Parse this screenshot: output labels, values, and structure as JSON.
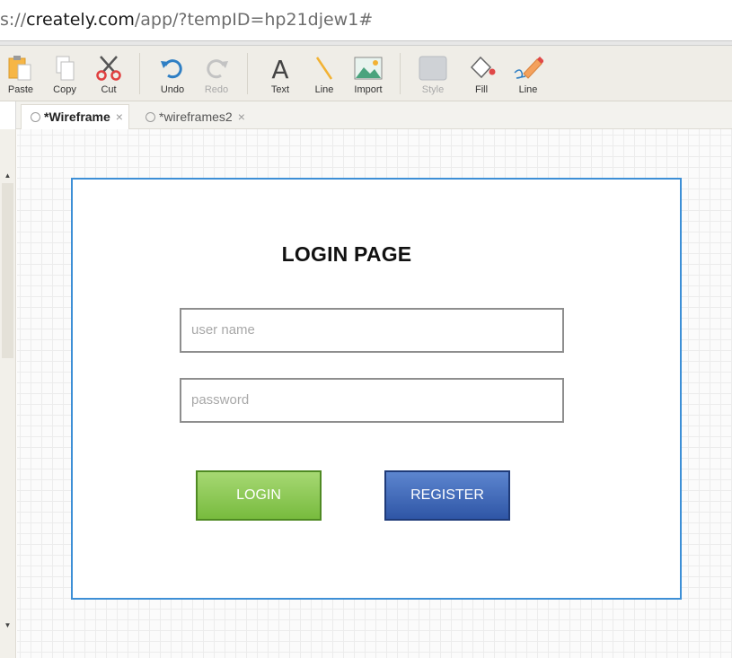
{
  "browser": {
    "url_prefix": "s://",
    "url_domain": "creately.com",
    "url_path": "/app/?tempID=hp21djew1#"
  },
  "toolbar": {
    "items": [
      {
        "label": "Paste",
        "icon": "paste-icon"
      },
      {
        "label": "Copy",
        "icon": "copy-icon"
      },
      {
        "label": "Cut",
        "icon": "scissors-icon"
      },
      {
        "label": "Undo",
        "icon": "undo-icon"
      },
      {
        "label": "Redo",
        "icon": "redo-icon"
      },
      {
        "label": "Text",
        "icon": "text-icon"
      },
      {
        "label": "Line",
        "icon": "line-icon"
      },
      {
        "label": "Import",
        "icon": "image-icon"
      },
      {
        "label": "Style",
        "icon": "style-swatch-icon"
      },
      {
        "label": "Fill",
        "icon": "fill-bucket-icon"
      },
      {
        "label": "Line",
        "icon": "pencil-line-icon"
      }
    ]
  },
  "tabs": [
    {
      "label": "*Wireframe",
      "active": true
    },
    {
      "label": "*wireframes2",
      "active": false
    }
  ],
  "wireframe": {
    "title": "LOGIN PAGE",
    "username_placeholder": "user name",
    "password_placeholder": "password",
    "login_label": "LOGIN",
    "register_label": "REGISTER"
  },
  "colors": {
    "frame_border": "#3d8fd6",
    "login_button": "#8ac957",
    "register_button": "#3d65b8"
  }
}
